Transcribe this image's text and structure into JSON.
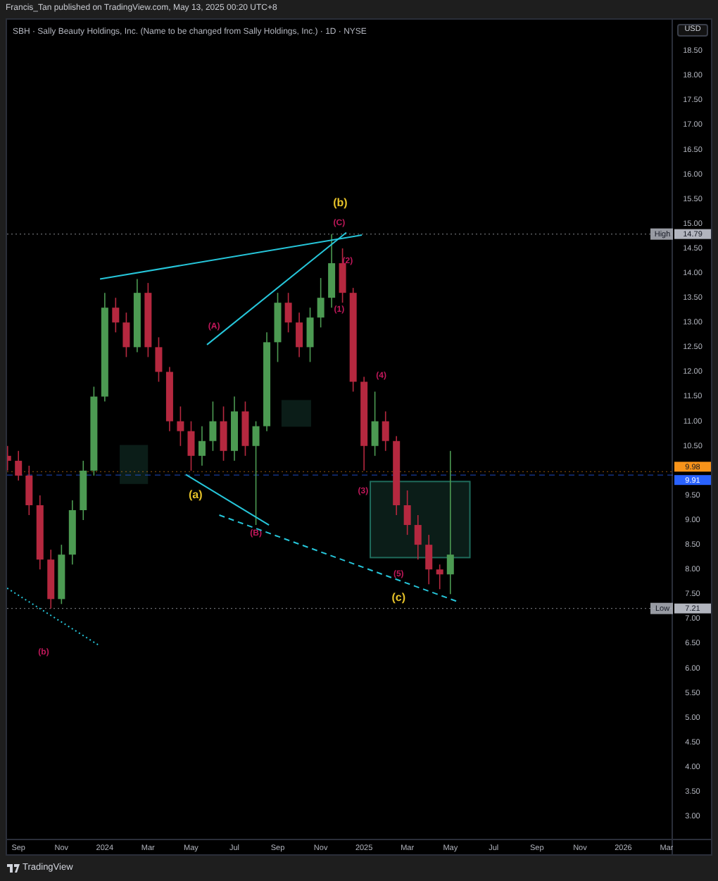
{
  "header": {
    "text": "Francis_Tan published on TradingView.com, May 13, 2025 00:20 UTC+8"
  },
  "chart": {
    "title": "SBH · Sally Beauty Holdings, Inc. (Name to be changed from Sally Holdings, Inc.) · 1D · NYSE",
    "currency": "USD",
    "chart_data": {
      "type": "candlestick",
      "x": [
        2023.625,
        2023.667,
        2023.708,
        2023.75,
        2023.792,
        2023.833,
        2023.875,
        2023.917,
        2023.958,
        2024.0,
        2024.042,
        2024.083,
        2024.125,
        2024.167,
        2024.208,
        2024.25,
        2024.292,
        2024.333,
        2024.375,
        2024.417,
        2024.458,
        2024.5,
        2024.542,
        2024.583,
        2024.625,
        2024.667,
        2024.708,
        2024.75,
        2024.792,
        2024.833,
        2024.875,
        2024.917,
        2024.958,
        2025.0,
        2025.042,
        2025.083,
        2025.125,
        2025.167,
        2025.208,
        2025.25,
        2025.292,
        2025.333
      ],
      "ohlc": [
        [
          10.3,
          10.5,
          10.0,
          10.2
        ],
        [
          10.2,
          10.4,
          9.8,
          9.9
        ],
        [
          9.9,
          10.1,
          9.1,
          9.3
        ],
        [
          9.3,
          9.5,
          8.0,
          8.2
        ],
        [
          8.2,
          8.4,
          7.21,
          7.4
        ],
        [
          7.4,
          8.5,
          7.3,
          8.3
        ],
        [
          8.3,
          9.4,
          8.1,
          9.2
        ],
        [
          9.2,
          10.2,
          9.0,
          10.0
        ],
        [
          10.0,
          11.7,
          9.9,
          11.5
        ],
        [
          11.5,
          13.6,
          11.4,
          13.3
        ],
        [
          13.3,
          13.5,
          12.8,
          13.0
        ],
        [
          13.0,
          13.2,
          12.3,
          12.5
        ],
        [
          12.5,
          13.88,
          12.4,
          13.6
        ],
        [
          13.6,
          13.8,
          12.3,
          12.5
        ],
        [
          12.5,
          12.7,
          11.8,
          12.0
        ],
        [
          12.0,
          12.1,
          10.8,
          11.0
        ],
        [
          11.0,
          11.3,
          10.5,
          10.8
        ],
        [
          10.8,
          11.0,
          10.0,
          10.3
        ],
        [
          10.3,
          10.9,
          10.1,
          10.6
        ],
        [
          10.6,
          11.4,
          10.4,
          11.0
        ],
        [
          11.0,
          11.3,
          10.2,
          10.4
        ],
        [
          10.4,
          11.5,
          10.2,
          11.2
        ],
        [
          11.2,
          11.4,
          10.3,
          10.5
        ],
        [
          10.5,
          11.0,
          8.9,
          10.9
        ],
        [
          10.9,
          12.8,
          10.8,
          12.6
        ],
        [
          12.6,
          13.6,
          12.2,
          13.4
        ],
        [
          13.4,
          13.6,
          12.8,
          13.0
        ],
        [
          13.0,
          13.2,
          12.3,
          12.5
        ],
        [
          12.5,
          13.3,
          12.2,
          13.1
        ],
        [
          13.1,
          13.9,
          12.9,
          13.5
        ],
        [
          13.5,
          14.79,
          13.3,
          14.2
        ],
        [
          14.2,
          14.5,
          13.4,
          13.6
        ],
        [
          13.6,
          13.7,
          11.6,
          11.8
        ],
        [
          11.8,
          11.9,
          10.0,
          10.5
        ],
        [
          10.5,
          11.6,
          10.3,
          11.0
        ],
        [
          11.0,
          11.2,
          10.4,
          10.6
        ],
        [
          10.6,
          10.7,
          9.1,
          9.3
        ],
        [
          9.3,
          9.6,
          8.7,
          8.9
        ],
        [
          8.9,
          9.1,
          8.2,
          8.5
        ],
        [
          8.5,
          8.7,
          7.7,
          8.0
        ],
        [
          8.0,
          8.1,
          7.6,
          7.9
        ],
        [
          7.9,
          10.4,
          7.5,
          8.3
        ]
      ],
      "ref_lines": [
        {
          "axis": "y",
          "value": 14.79
        },
        {
          "axis": "y",
          "value": 9.98
        },
        {
          "axis": "y",
          "value": 9.91
        },
        {
          "axis": "y",
          "value": 7.21
        }
      ],
      "xlim": [
        2023.623,
        2026.197
      ],
      "ylim": [
        2.49,
        19.13
      ],
      "xticks": [
        {
          "value": 2023.667,
          "label": "Sep"
        },
        {
          "value": 2023.833,
          "label": "Nov"
        },
        {
          "value": 2024,
          "label": "2024"
        },
        {
          "value": 2024.167,
          "label": "Mar"
        },
        {
          "value": 2024.333,
          "label": "May"
        },
        {
          "value": 2024.5,
          "label": "Jul"
        },
        {
          "value": 2024.667,
          "label": "Sep"
        },
        {
          "value": 2024.833,
          "label": "Nov"
        },
        {
          "value": 2025,
          "label": "2025"
        },
        {
          "value": 2025.167,
          "label": "Mar"
        },
        {
          "value": 2025.333,
          "label": "May"
        },
        {
          "value": 2025.5,
          "label": "Jul"
        },
        {
          "value": 2025.667,
          "label": "Sep"
        },
        {
          "value": 2025.833,
          "label": "Nov"
        },
        {
          "value": 2026,
          "label": "2026"
        },
        {
          "value": 2026.167,
          "label": "Mar"
        }
      ],
      "yticks": [
        {
          "value": 3,
          "label": "3.00"
        },
        {
          "value": 3.5,
          "label": "3.50"
        },
        {
          "value": 4,
          "label": "4.00"
        },
        {
          "value": 4.5,
          "label": "4.50"
        },
        {
          "value": 5,
          "label": "5.00"
        },
        {
          "value": 5.5,
          "label": "5.50"
        },
        {
          "value": 6,
          "label": "6.00"
        },
        {
          "value": 6.5,
          "label": "6.50"
        },
        {
          "value": 7,
          "label": "7.00"
        },
        {
          "value": 7.5,
          "label": "7.50"
        },
        {
          "value": 8,
          "label": "8.00"
        },
        {
          "value": 8.5,
          "label": "8.50"
        },
        {
          "value": 9,
          "label": "9.00"
        },
        {
          "value": 9.5,
          "label": "9.50"
        },
        {
          "value": 10.5,
          "label": "10.50"
        },
        {
          "value": 11,
          "label": "11.00"
        },
        {
          "value": 11.5,
          "label": "11.50"
        },
        {
          "value": 12,
          "label": "12.00"
        },
        {
          "value": 12.5,
          "label": "12.50"
        },
        {
          "value": 13,
          "label": "13.00"
        },
        {
          "value": 13.5,
          "label": "13.50"
        },
        {
          "value": 14,
          "label": "14.00"
        },
        {
          "value": 14.5,
          "label": "14.50"
        },
        {
          "value": 15,
          "label": "15.00"
        },
        {
          "value": 15.5,
          "label": "15.50"
        },
        {
          "value": 16,
          "label": "16.00"
        },
        {
          "value": 16.5,
          "label": "16.50"
        },
        {
          "value": 17,
          "label": "17.00"
        },
        {
          "value": 17.5,
          "label": "17.50"
        },
        {
          "value": 18,
          "label": "18.00"
        },
        {
          "value": 18.5,
          "label": "18.50"
        }
      ]
    },
    "price_tags": [
      {
        "label": "High",
        "value": "14.79",
        "color": "#b2b5be"
      },
      {
        "value": "9.98",
        "color": "#f7931a"
      },
      {
        "value": "9.91",
        "color": "#2962ff"
      },
      {
        "label": "Low",
        "value": "7.21",
        "color": "#b2b5be"
      }
    ],
    "wave_labels": [
      {
        "text": "(b)",
        "color": "#e6c229"
      },
      {
        "text": "(C)",
        "color": "#c2185b"
      },
      {
        "text": "(2)",
        "color": "#c2185b"
      },
      {
        "text": "(1)",
        "color": "#c2185b"
      },
      {
        "text": "(A)",
        "color": "#c2185b"
      },
      {
        "text": "(4)",
        "color": "#c2185b"
      },
      {
        "text": "(3)",
        "color": "#c2185b"
      },
      {
        "text": "(a)",
        "color": "#e6c229"
      },
      {
        "text": "(B)",
        "color": "#c2185b"
      },
      {
        "text": "(5)",
        "color": "#c2185b"
      },
      {
        "text": "(c)",
        "color": "#e6c229"
      },
      {
        "text": "(b)",
        "color": "#c2185b"
      }
    ]
  },
  "footer": {
    "brand": "TradingView"
  }
}
